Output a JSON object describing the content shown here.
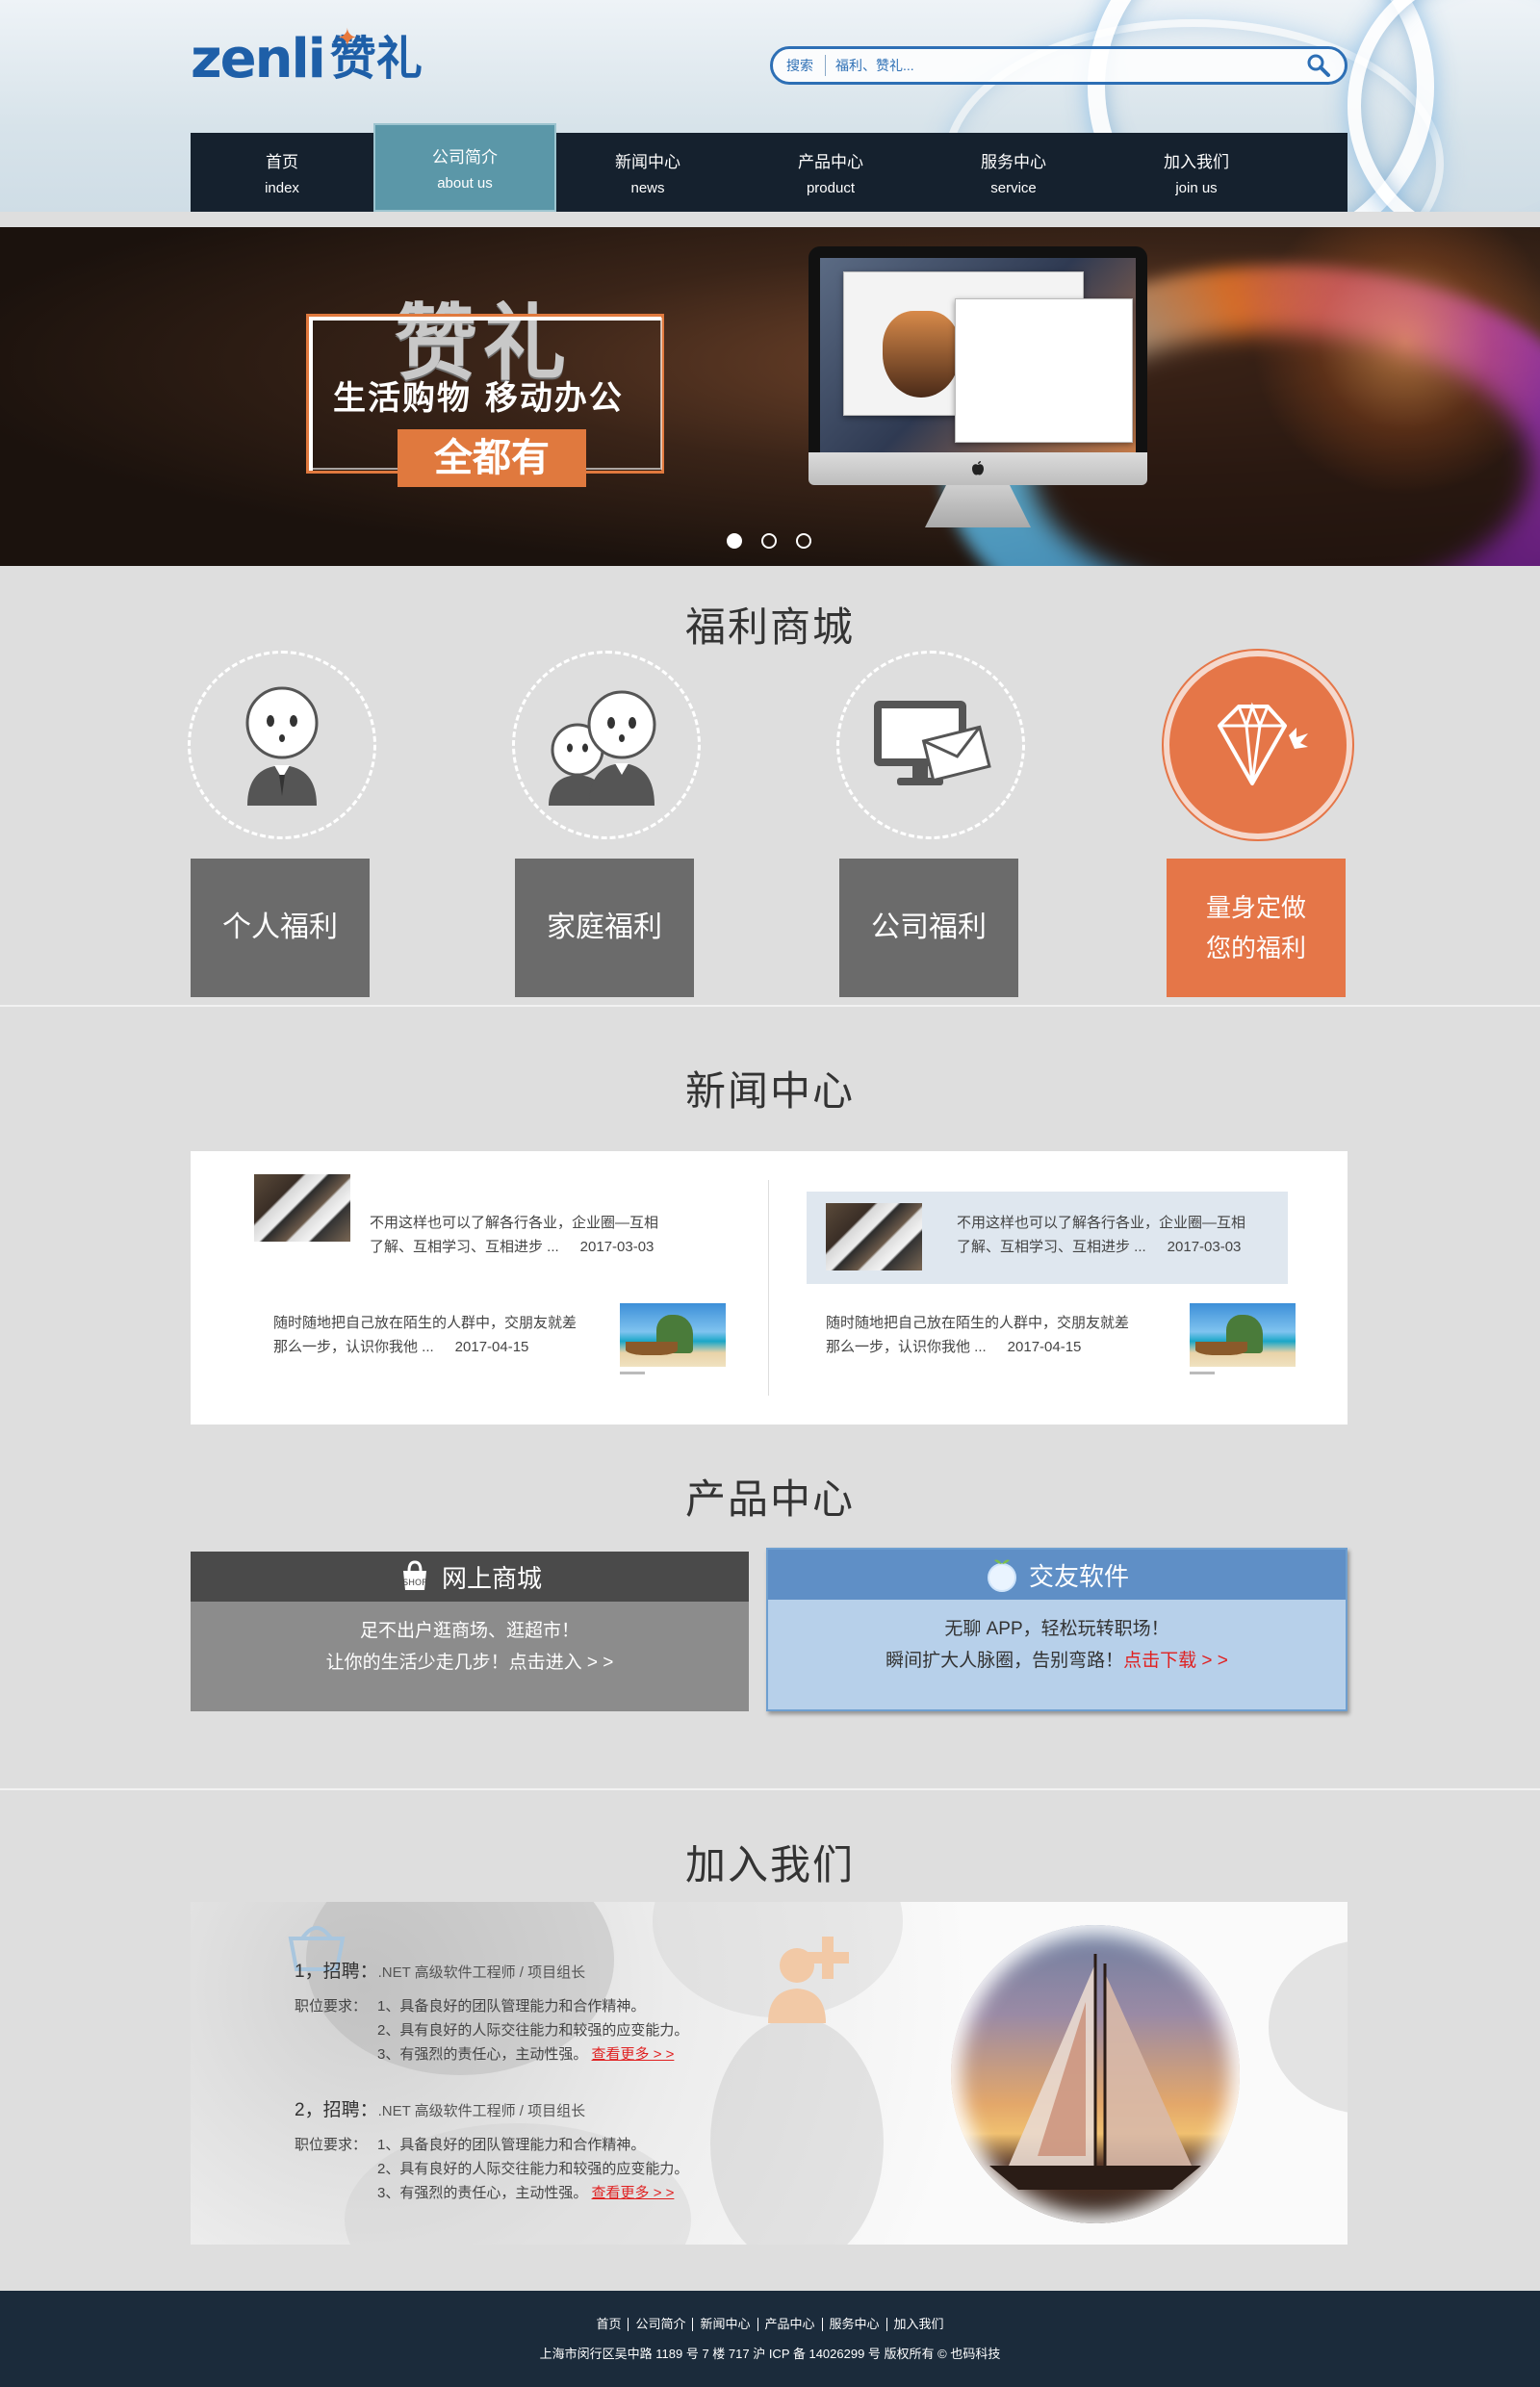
{
  "logo": {
    "latin": "zenli",
    "cn": "赞礼"
  },
  "search": {
    "label": "搜索",
    "placeholder": "福利、赞礼..."
  },
  "nav": [
    {
      "cn": "首页",
      "en": "index"
    },
    {
      "cn": "公司简介",
      "en": "about us"
    },
    {
      "cn": "新闻中心",
      "en": "news"
    },
    {
      "cn": "产品中心",
      "en": "product"
    },
    {
      "cn": "服务中心",
      "en": "service"
    },
    {
      "cn": "加入我们",
      "en": "join us"
    }
  ],
  "banner": {
    "title": "赞礼",
    "subtitle": "生活购物  移动办公",
    "tag": "全都有",
    "slides_count": 3,
    "active_slide": 1
  },
  "welfare": {
    "title": "福利商城",
    "cards": [
      {
        "label": "个人福利",
        "icon": "person-icon"
      },
      {
        "label": "家庭福利",
        "icon": "family-icon"
      },
      {
        "label": "公司福利",
        "icon": "monitor-mail-icon"
      },
      {
        "label_line1": "量身定做",
        "label_line2": "您的福利",
        "icon": "diamond-icon"
      }
    ]
  },
  "news": {
    "title": "新闻中心",
    "items": [
      {
        "line1": "不用这样也可以了解各行各业，企业圈—互相",
        "line2": "了解、互相学习、互相进步 ...",
        "date": "2017-03-03"
      },
      {
        "line1": "随时随地把自己放在陌生的人群中，交朋友就差",
        "line2": "那么一步，认识你我他 ...",
        "date": "2017-04-15"
      },
      {
        "line1": "不用这样也可以了解各行各业，企业圈—互相",
        "line2": "了解、互相学习、互相进步 ...",
        "date": "2017-03-03"
      },
      {
        "line1": "随时随地把自己放在陌生的人群中，交朋友就差",
        "line2": "那么一步，认识你我他 ...",
        "date": "2017-04-15"
      }
    ]
  },
  "products": {
    "title": "产品中心",
    "left": {
      "title": "网上商城",
      "line1": "足不出户逛商场、逛超市！",
      "line2": "让你的生活少走几步！点击进入 > >"
    },
    "right": {
      "title": "交友软件",
      "line1": "无聊 APP，轻松玩转职场！",
      "line2_prefix": "瞬间扩大人脉圈，告别弯路！",
      "line2_link": "点击下载 > >"
    }
  },
  "join": {
    "title": "加入我们",
    "jobs": [
      {
        "num": "1，招聘：",
        "role": ".NET 高级软件工程师 / 项目组长",
        "req_key": "职位要求：",
        "reqs": [
          "1、具备良好的团队管理能力和合作精神。",
          "2、具有良好的人际交往能力和较强的应变能力。",
          "3、有强烈的责任心，主动性强。"
        ],
        "more": "查看更多 > >"
      },
      {
        "num": "2，招聘：",
        "role": ".NET 高级软件工程师 / 项目组长",
        "req_key": "职位要求：",
        "reqs": [
          "1、具备良好的团队管理能力和合作精神。",
          "2、具有良好的人际交往能力和较强的应变能力。",
          "3、有强烈的责任心，主动性强。"
        ],
        "more": "查看更多 > >"
      }
    ]
  },
  "footer": {
    "links": [
      "首页",
      "公司简介",
      "新闻中心",
      "产品中心",
      "服务中心",
      "加入我们"
    ],
    "copy": "上海市闵行区吴中路 1189 号 7 楼 717  沪 ICP 备 14026299 号    版权所有 © 也码科技"
  },
  "colors": {
    "brand_blue": "#1e5fa8",
    "accent_orange": "#e57648",
    "nav_bg": "#15212e",
    "nav_active": "#5b97a8",
    "footer_bg": "#1b2b3b"
  }
}
